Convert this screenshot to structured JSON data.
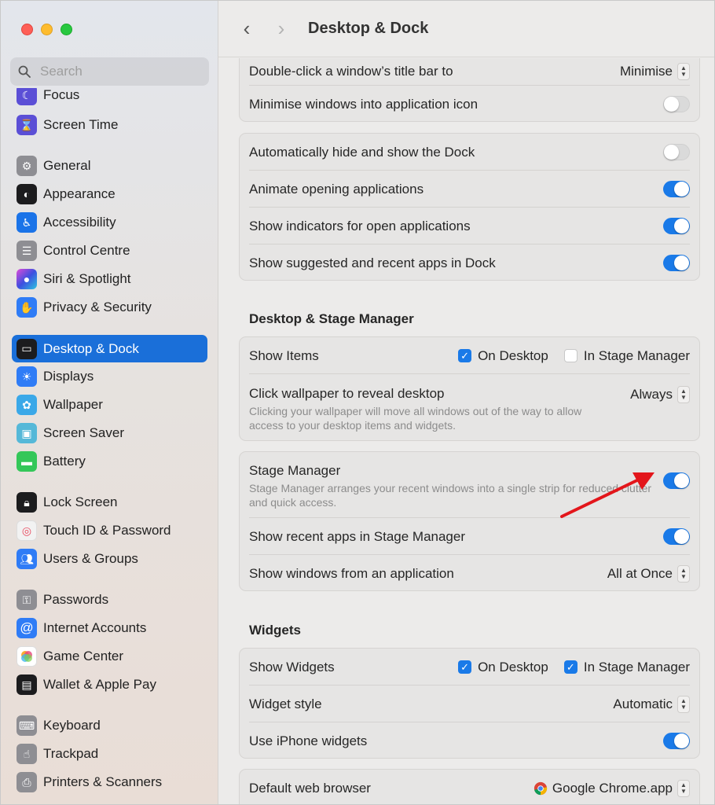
{
  "window": {
    "title": "Desktop & Dock"
  },
  "search": {
    "placeholder": "Search"
  },
  "sidebar": {
    "items": [
      {
        "label": "Focus",
        "icon": "moon-icon",
        "color": "#5b4fd6"
      },
      {
        "label": "Screen Time",
        "icon": "hourglass-icon",
        "color": "#5b4fd6"
      },
      {
        "label": "General",
        "icon": "gear-icon",
        "color": "#8e8e93"
      },
      {
        "label": "Appearance",
        "icon": "appearance-icon",
        "color": "#1c1c1e"
      },
      {
        "label": "Accessibility",
        "icon": "accessibility-icon",
        "color": "#1a73e8"
      },
      {
        "label": "Control Centre",
        "icon": "control-centre-icon",
        "color": "#8e8e93"
      },
      {
        "label": "Siri & Spotlight",
        "icon": "siri-icon",
        "color": "#7b3fd0"
      },
      {
        "label": "Privacy & Security",
        "icon": "hand-icon",
        "color": "#2f7cf6"
      },
      {
        "label": "Desktop & Dock",
        "icon": "dock-icon",
        "color": "#1c1c1e"
      },
      {
        "label": "Displays",
        "icon": "sun-icon",
        "color": "#2f7cf6"
      },
      {
        "label": "Wallpaper",
        "icon": "flower-icon",
        "color": "#3aa8e8"
      },
      {
        "label": "Screen Saver",
        "icon": "screen-saver-icon",
        "color": "#55b8d8"
      },
      {
        "label": "Battery",
        "icon": "battery-icon",
        "color": "#34c759"
      },
      {
        "label": "Lock Screen",
        "icon": "lock-icon",
        "color": "#1c1c1e"
      },
      {
        "label": "Touch ID & Password",
        "icon": "fingerprint-icon",
        "color": "#f2f2f2"
      },
      {
        "label": "Users & Groups",
        "icon": "users-icon",
        "color": "#2f7cf6"
      },
      {
        "label": "Passwords",
        "icon": "key-icon",
        "color": "#8e8e93"
      },
      {
        "label": "Internet Accounts",
        "icon": "at-icon",
        "color": "#2f7cf6"
      },
      {
        "label": "Game Center",
        "icon": "game-center-icon",
        "color": "#ffffff"
      },
      {
        "label": "Wallet & Apple Pay",
        "icon": "wallet-icon",
        "color": "#1c1c1e"
      },
      {
        "label": "Keyboard",
        "icon": "keyboard-icon",
        "color": "#8e8e93"
      },
      {
        "label": "Trackpad",
        "icon": "trackpad-icon",
        "color": "#8e8e93"
      },
      {
        "label": "Printers & Scanners",
        "icon": "printer-icon",
        "color": "#8e8e93"
      }
    ],
    "active": "Desktop & Dock",
    "accent": "#1a6fd9"
  },
  "groups": {
    "window": {
      "double_click_label": "Double-click a window’s title bar to",
      "double_click_value": "Minimise",
      "minimise_label": "Minimise windows into application icon",
      "minimise_on": false
    },
    "dock": {
      "autohide_label": "Automatically hide and show the Dock",
      "animate_label": "Animate opening applications",
      "indicators_label": "Show indicators for open applications",
      "suggested_label": "Show suggested and recent apps in Dock"
    },
    "stage": {
      "section_title": "Desktop & Stage Manager",
      "show_items_label": "Show Items",
      "on_desktop": "On Desktop",
      "in_stage_manager": "In Stage Manager",
      "click_wallpaper_label": "Click wallpaper to reveal desktop",
      "click_wallpaper_desc": "Clicking your wallpaper will move all windows out of the way to allow access to your desktop items and widgets.",
      "click_wallpaper_value": "Always",
      "stage_manager_label": "Stage Manager",
      "stage_manager_desc": "Stage Manager arranges your recent windows into a single strip for reduced clutter and quick access.",
      "recent_apps_label": "Show recent apps in Stage Manager",
      "windows_from_app_label": "Show windows from an application",
      "windows_from_app_value": "All at Once"
    },
    "widgets": {
      "section_title": "Widgets",
      "show_widgets_label": "Show Widgets",
      "on_desktop": "On Desktop",
      "in_stage_manager": "In Stage Manager",
      "style_label": "Widget style",
      "style_value": "Automatic",
      "iphone_label": "Use iPhone widgets"
    },
    "browser": {
      "label": "Default web browser",
      "value": "Google Chrome.app"
    }
  },
  "colors": {
    "toggle_on": "#1a7ae8",
    "annotation_arrow": "#e3161b"
  }
}
